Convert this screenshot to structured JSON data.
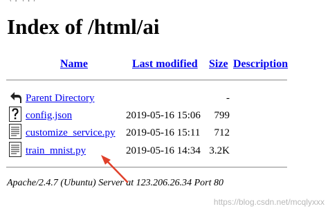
{
  "top_crop_text": "\\ . \\ . /",
  "page": {
    "title": "Index of /html/ai"
  },
  "table": {
    "headers": {
      "name": "Name",
      "last_modified": "Last modified",
      "size": "Size",
      "description": "Description"
    },
    "rows": [
      {
        "name": "Parent Directory",
        "modified": "",
        "size": "-",
        "icon": "parent-directory-icon"
      },
      {
        "name": "config.json",
        "modified": "2019-05-16 15:06",
        "size": "799",
        "icon": "unknown-file-icon"
      },
      {
        "name": "customize_service.py",
        "modified": "2019-05-16 15:11",
        "size": "712",
        "icon": "text-file-icon"
      },
      {
        "name": "train_mnist.py",
        "modified": "2019-05-16 14:34",
        "size": "3.2K",
        "icon": "text-file-icon"
      }
    ]
  },
  "footer": {
    "address": "Apache/2.4.7 (Ubuntu) Server at 123.206.26.34 Port 80"
  },
  "watermark": "https://blog.csdn.net/mcqlyxxx",
  "colors": {
    "link": "#0000ee",
    "arrow": "#e0402a"
  }
}
